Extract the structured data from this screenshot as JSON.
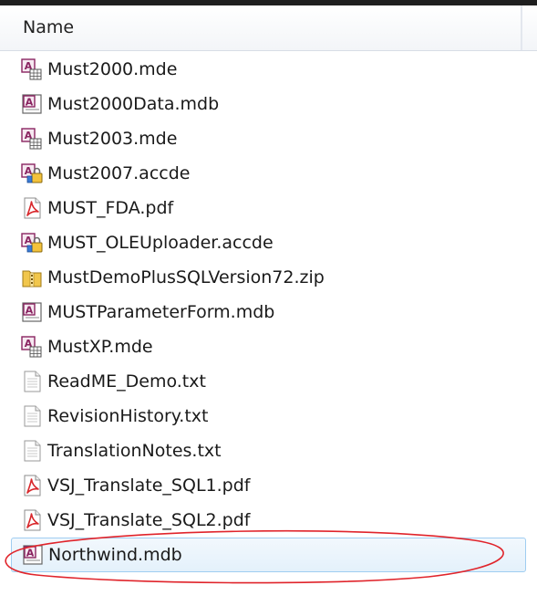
{
  "list": {
    "column_header": "Name",
    "files": [
      {
        "name": "Must2000.mde",
        "icon": "access-mde-icon"
      },
      {
        "name": "Must2000Data.mdb",
        "icon": "access-mdb-icon"
      },
      {
        "name": "Must2003.mde",
        "icon": "access-mde-icon"
      },
      {
        "name": "Must2007.accde",
        "icon": "access-accde-icon"
      },
      {
        "name": "MUST_FDA.pdf",
        "icon": "pdf-icon"
      },
      {
        "name": "MUST_OLEUploader.accde",
        "icon": "access-accde-icon"
      },
      {
        "name": "MustDemoPlusSQLVersion72.zip",
        "icon": "zip-folder-icon"
      },
      {
        "name": "MUSTParameterForm.mdb",
        "icon": "access-mdb-icon"
      },
      {
        "name": "MustXP.mde",
        "icon": "access-mde-icon"
      },
      {
        "name": "ReadME_Demo.txt",
        "icon": "text-file-icon"
      },
      {
        "name": "RevisionHistory.txt",
        "icon": "text-file-icon"
      },
      {
        "name": "TranslationNotes.txt",
        "icon": "text-file-icon"
      },
      {
        "name": "VSJ_Translate_SQL1.pdf",
        "icon": "pdf-icon"
      },
      {
        "name": "VSJ_Translate_SQL2.pdf",
        "icon": "pdf-icon"
      },
      {
        "name": "Northwind.mdb",
        "icon": "access-mdb-icon",
        "selected": true
      }
    ]
  },
  "colors": {
    "selection_border": "#9fcdf1",
    "selection_fill": "#e4f1fb",
    "annotation": "#e0242b",
    "pdf_red": "#d8282c",
    "access_purple": "#8a2461"
  }
}
